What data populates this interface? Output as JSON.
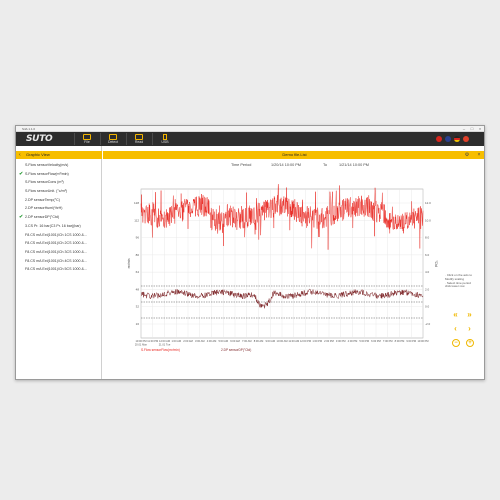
{
  "window": {
    "title": "S4A  1.1.0"
  },
  "toolbar": {
    "logo_text": "SUTO",
    "buttons": [
      {
        "label": "File",
        "icon": "folder-icon"
      },
      {
        "label": "Detect",
        "icon": "detect-icon"
      },
      {
        "label": "Read",
        "icon": "read-icon"
      },
      {
        "label": "USB",
        "icon": "usb-icon"
      }
    ],
    "flag_colors": [
      "#d7261d",
      "#2a3f8f",
      "#222222",
      "#e0402a"
    ]
  },
  "left_panel": {
    "header": "Graphic View",
    "sensors": [
      {
        "label": "S.Flow sensorVelocity(m/s)",
        "checked": false
      },
      {
        "label": "S.Flow sensorFlow(m³/min)",
        "checked": true
      },
      {
        "label": "S.Flow sensorCons (m³)",
        "checked": false
      },
      {
        "label": "S.Flow sensorUnit. (°c/m³)",
        "checked": false
      },
      {
        "label": "2.DP sensorTemp(°C)",
        "checked": false
      },
      {
        "label": "2.DP sensorHumi(%rH)",
        "checked": false
      },
      {
        "label": "2.DP sensorDP(°Ctd)",
        "checked": true
      },
      {
        "label": "3.CS Pr. 16 bar(C3 Pr. 16 bar)(bar)",
        "checked": false
      },
      {
        "label": "F8.CS mA Ext(1001)/Ch 1CS 1000 &...",
        "checked": false
      },
      {
        "label": "F8.CS mA Ext(1001)/Ch 2CS 1000 &...",
        "checked": false
      },
      {
        "label": "F8.CS mA Ext(1001)/Ch 3CS 1000 &...",
        "checked": false
      },
      {
        "label": "F8.CS mA Ext(1001)/Ch 4CS 1000 &...",
        "checked": false
      },
      {
        "label": "F8.CS mA Ext(1001)/Ch 5CS 1000 &...",
        "checked": false
      }
    ]
  },
  "main": {
    "header": "Demo file.List",
    "time_period_label": "Time Period",
    "time_from": "1/20/14 10:00 PM",
    "time_to_label": "To",
    "time_to": "1/21/14 10:00 PM"
  },
  "chart_data": {
    "type": "line",
    "left_ylabel": "m³/min",
    "right_ylabel": "°Ctd",
    "left_ticks": [
      "128",
      "112",
      "96",
      "80",
      "64",
      "48",
      "32",
      "16"
    ],
    "right_ticks": [
      "12.0",
      "10.0",
      "8.0",
      "6.0",
      "4.0",
      "2.0",
      "0.0",
      "-2.0"
    ],
    "x_ticks": [
      "10:00 PM",
      "11:00 PM",
      "12:00 AM",
      "1:00 AM",
      "2:00 AM",
      "3:00 AM",
      "4:00 AM",
      "5:00 AM",
      "6:00 AM",
      "7:00 AM",
      "8:00 AM",
      "9:00 AM",
      "10:00 AM",
      "11:00 AM",
      "12:00 PM",
      "1:00 PM",
      "2:00 PM",
      "3:00 PM",
      "4:00 PM",
      "5:00 PM",
      "6:00 PM",
      "7:00 PM",
      "8:00 PM",
      "9:00 PM",
      "10:00 PM"
    ],
    "x_sub_first": "20.01 Mon",
    "x_sub_second": "21.01 Tue",
    "series": [
      {
        "name": "S.Flow sensorFlow(m³/min)",
        "color": "#e8201a",
        "approx_level": 110,
        "approx_range": [
          88,
          128
        ]
      },
      {
        "name": "2.DP sensorDP(°Ctd)",
        "color": "#7a1f22",
        "approx_level": 1.5,
        "approx_range": [
          0.5,
          3.0
        ]
      }
    ],
    "grid": true,
    "legend": "bottom-left"
  },
  "help": {
    "lines": [
      "· Click on the axis to",
      "  Modify scaling",
      "· Select time period",
      "  click lower row"
    ]
  },
  "nav": {
    "up": "«",
    "left": "‹",
    "right": "›",
    "down": "»",
    "zoom_in": "+",
    "zoom_out": "−"
  }
}
